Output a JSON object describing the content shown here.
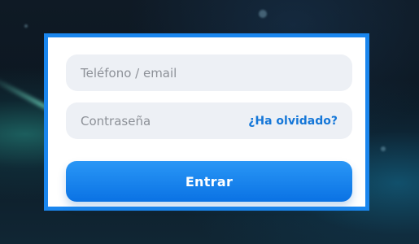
{
  "login_form": {
    "phone_email_placeholder": "Teléfono / email",
    "password_placeholder": "Contraseña",
    "forgot_label": "¿Ha olvidado?",
    "submit_label": "Entrar"
  },
  "colors": {
    "accent": "#1a86ee",
    "button_top": "#2a97f6",
    "button_bottom": "#0a72e4",
    "link": "#1577d8",
    "field_bg": "#edf0f5"
  }
}
